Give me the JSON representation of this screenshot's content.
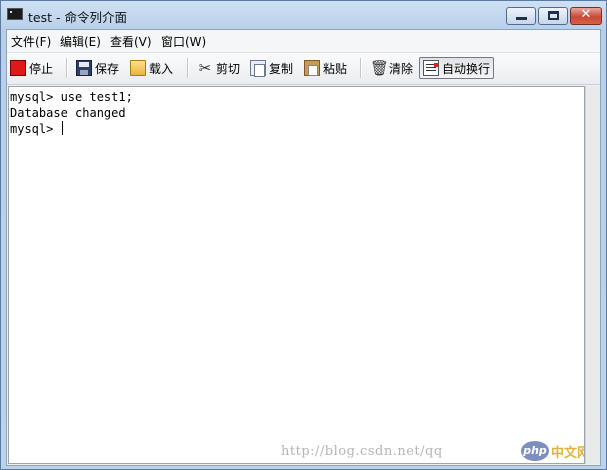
{
  "window": {
    "title": "test - 命令列介面",
    "close_glyph": "✕"
  },
  "menu": [
    "文件(F)",
    "编辑(E)",
    "查看(V)",
    "窗口(W)"
  ],
  "toolbar": {
    "stop": "停止",
    "save": "保存",
    "load": "载入",
    "cut": "剪切",
    "copy": "复制",
    "paste": "粘贴",
    "clear": "清除",
    "wrap": "自动换行"
  },
  "console": {
    "lines": [
      "mysql> use test1;",
      "Database changed",
      "mysql> "
    ]
  },
  "watermark": {
    "url": "http://blog.csdn.net/qq",
    "badge": "php",
    "site": "中文网"
  },
  "colors": {
    "stop_icon": "#e01818",
    "title_bar": "#b7cfe9",
    "close_button": "#c74b36"
  }
}
